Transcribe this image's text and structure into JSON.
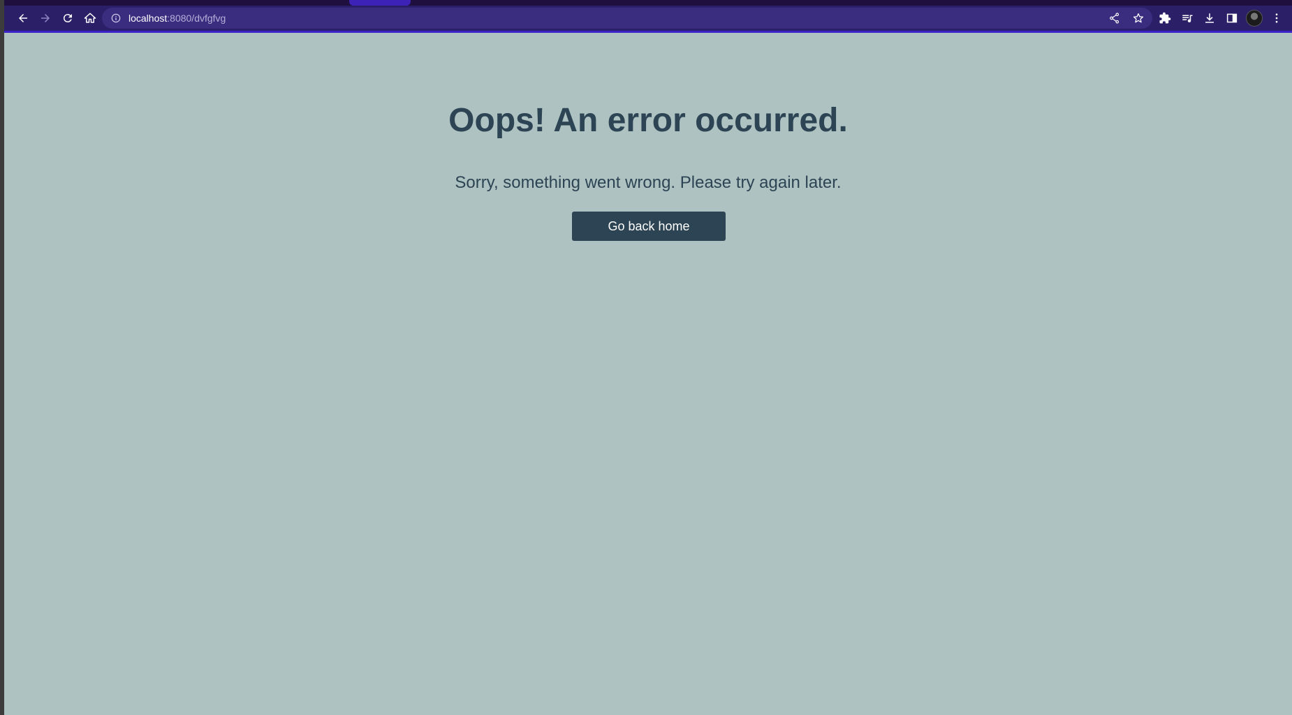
{
  "browser": {
    "url_host": "localhost",
    "url_path": ":8080/dvfgfvg",
    "colors": {
      "toolbar": "#2b1f68",
      "tabstrip": "#1e0f3f",
      "accent": "#3b22c8"
    },
    "icons": {
      "back": "arrow-left-icon",
      "forward": "arrow-right-icon",
      "reload": "reload-icon",
      "home": "home-icon",
      "site_info": "info-icon",
      "share": "share-icon",
      "bookmark": "star-icon",
      "extensions": "puzzle-icon",
      "media": "media-queue-icon",
      "downloads": "download-icon",
      "side_panel": "side-panel-icon",
      "profile": "avatar",
      "menu": "kebab-menu-icon"
    }
  },
  "page": {
    "heading": "Oops! An error occurred.",
    "message": "Sorry, something went wrong. Please try again later.",
    "home_button_label": "Go back home",
    "colors": {
      "background": "#aec2c2",
      "text": "#2c4453",
      "button_bg": "#2c4453",
      "button_text": "#ffffff"
    }
  }
}
